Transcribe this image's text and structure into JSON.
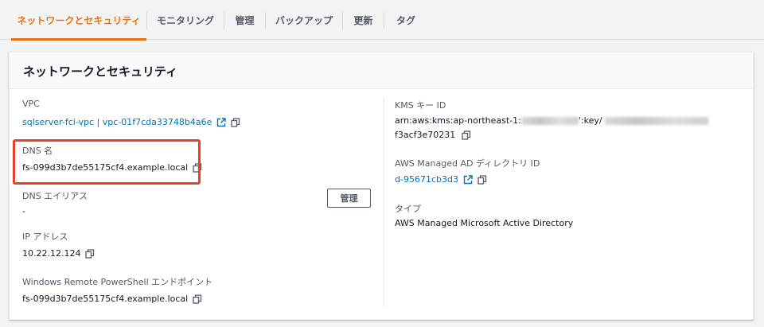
{
  "tabs": [
    {
      "label": "ネットワークとセキュリティ",
      "active": true
    },
    {
      "label": "モニタリング",
      "active": false
    },
    {
      "label": "管理",
      "active": false
    },
    {
      "label": "バックアップ",
      "active": false
    },
    {
      "label": "更新",
      "active": false
    },
    {
      "label": "タグ",
      "active": false
    }
  ],
  "panel": {
    "title": "ネットワークとセキュリティ",
    "manage_button": "管理",
    "left": {
      "vpc_label": "VPC",
      "vpc_value": "sqlserver-fci-vpc | vpc-01f7cda33748b4a6e",
      "dns_label": "DNS 名",
      "dns_value": "fs-099d3b7de55175cf4.example.local",
      "dns_alias_label": "DNS エイリアス",
      "dns_alias_value": "-",
      "ip_label": "IP アドレス",
      "ip_value": "10.22.12.124",
      "ps_label": "Windows Remote PowerShell エンドポイント",
      "ps_value": "fs-099d3b7de55175cf4.example.local"
    },
    "right": {
      "kms_label": "KMS キー ID",
      "kms_prefix": "arn:aws:kms:ap-northeast-1:",
      "kms_mid": "':key/",
      "kms_suffix": "f3acf3e70231",
      "ad_label": "AWS Managed AD ディレクトリ ID",
      "ad_value": "d-95671cb3d3",
      "type_label": "タイプ",
      "type_value": "AWS Managed Microsoft Active Directory"
    }
  },
  "colors": {
    "accent": "#ec7211",
    "link": "#0073bb",
    "highlight": "#e8402a"
  },
  "icons": {
    "external": "external-link-icon",
    "copy": "copy-icon"
  }
}
